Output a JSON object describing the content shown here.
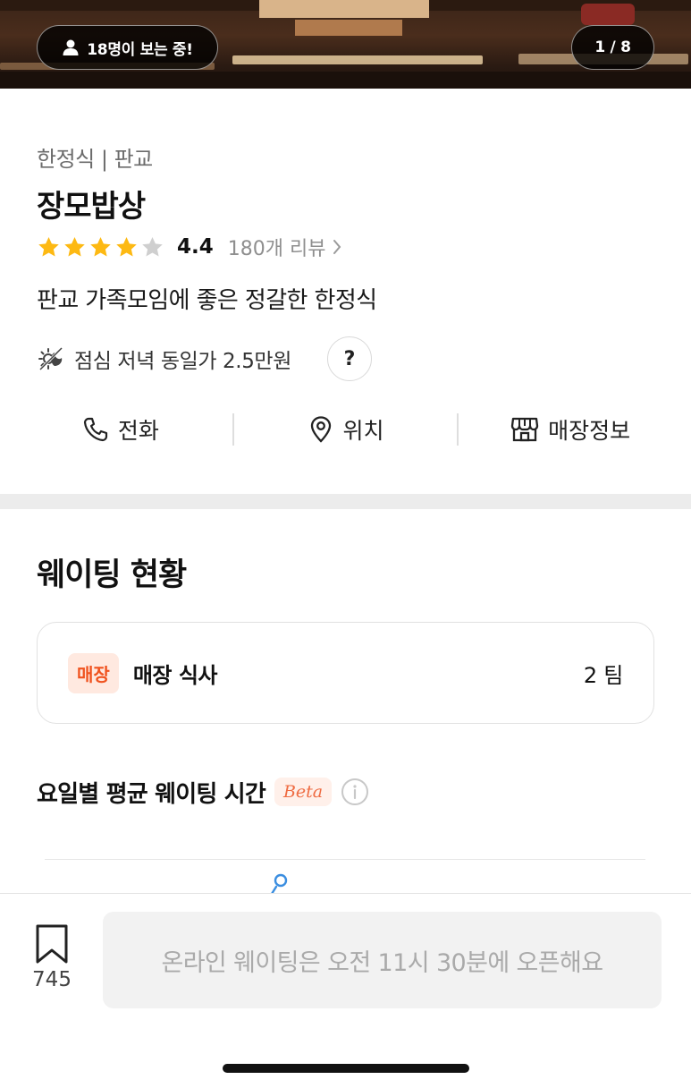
{
  "hero": {
    "viewers_text": "18명이 보는 중!",
    "pager_text": "1 / 8"
  },
  "restaurant": {
    "category": "한정식 | 판교",
    "name": "장모밥상",
    "rating": "4.4",
    "rating_stars": 4,
    "review_text": "180개 리뷰",
    "tagline": "판교 가족모임에 좋은 정갈한 한정식",
    "price_text": "점심 저녁 동일가 2.5만원",
    "help_label": "?"
  },
  "actions": [
    {
      "label": "전화",
      "icon": "phone-icon"
    },
    {
      "label": "위치",
      "icon": "location-pin-icon"
    },
    {
      "label": "매장정보",
      "icon": "store-icon"
    }
  ],
  "waiting": {
    "title": "웨이팅 현황",
    "badge": "매장",
    "seat_label": "매장 식사",
    "team_count": "2 팀",
    "avg_title": "요일별 평균 웨이팅 시간",
    "beta": "Beta"
  },
  "bottom": {
    "bookmark_count": "745",
    "cta": "온라인 웨이팅은 오전 11시 30분에 오픈해요"
  },
  "colors": {
    "star": "#FDB913",
    "star_empty": "#CFCFCF",
    "accent": "#F0531F"
  }
}
